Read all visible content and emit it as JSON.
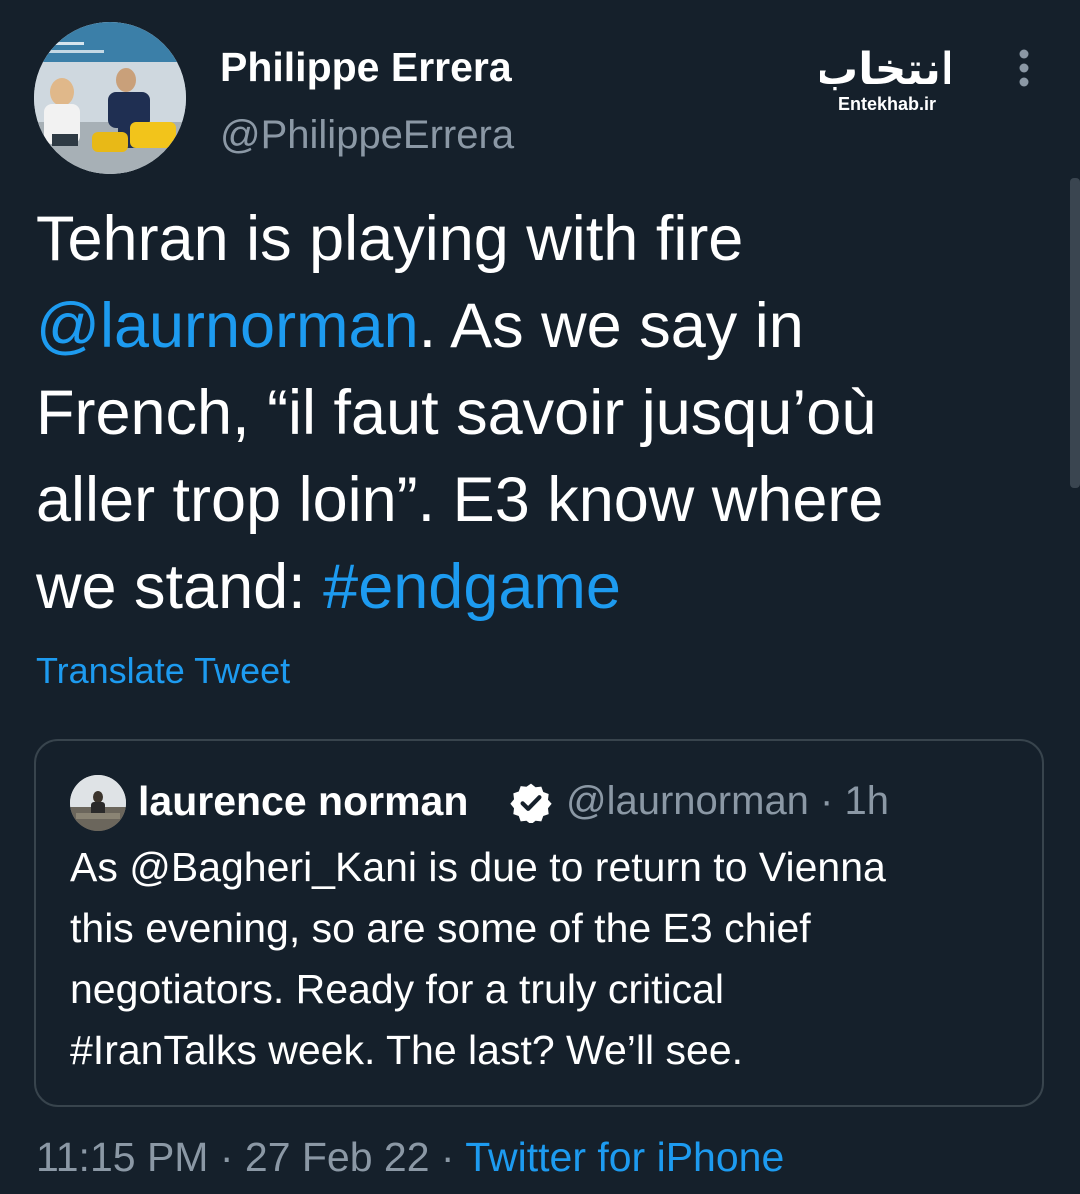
{
  "author": {
    "display_name": "Philippe Errera",
    "handle": "@PhilippeErrera"
  },
  "watermark": {
    "caption": "Entekhab.ir",
    "logo_text": "انتخاب"
  },
  "tweet": {
    "line1": "Tehran is playing with fire",
    "mention": "@laurnorman",
    "line2_rest": ". As we say in",
    "line3": "French, “il faut savoir jusqu’où",
    "line4": "aller trop loin”. E3 know where",
    "line5_start": "we stand: ",
    "hashtag": "#endgame"
  },
  "translate_label": "Translate Tweet",
  "quoted": {
    "name": "laurence norman",
    "handle": "@laurnorman",
    "separator": " · ",
    "time": "1h",
    "lines": [
      "As @Bagheri_Kani is due to return to Vienna",
      "this evening, so are some of the E3 chief",
      "negotiators. Ready for a truly critical",
      "#IranTalks week. The last? We’ll see."
    ]
  },
  "footer": {
    "time": "11:15 PM",
    "sep1": " · ",
    "date": "27 Feb 22",
    "sep2": " · ",
    "source": "Twitter for iPhone"
  },
  "colors": {
    "background": "#15202b",
    "link": "#1d9bf0",
    "secondary_text": "#8b98a5",
    "border": "#38444d"
  },
  "icons": {
    "more": "more-vertical-icon",
    "verified": "verified-badge-icon"
  }
}
